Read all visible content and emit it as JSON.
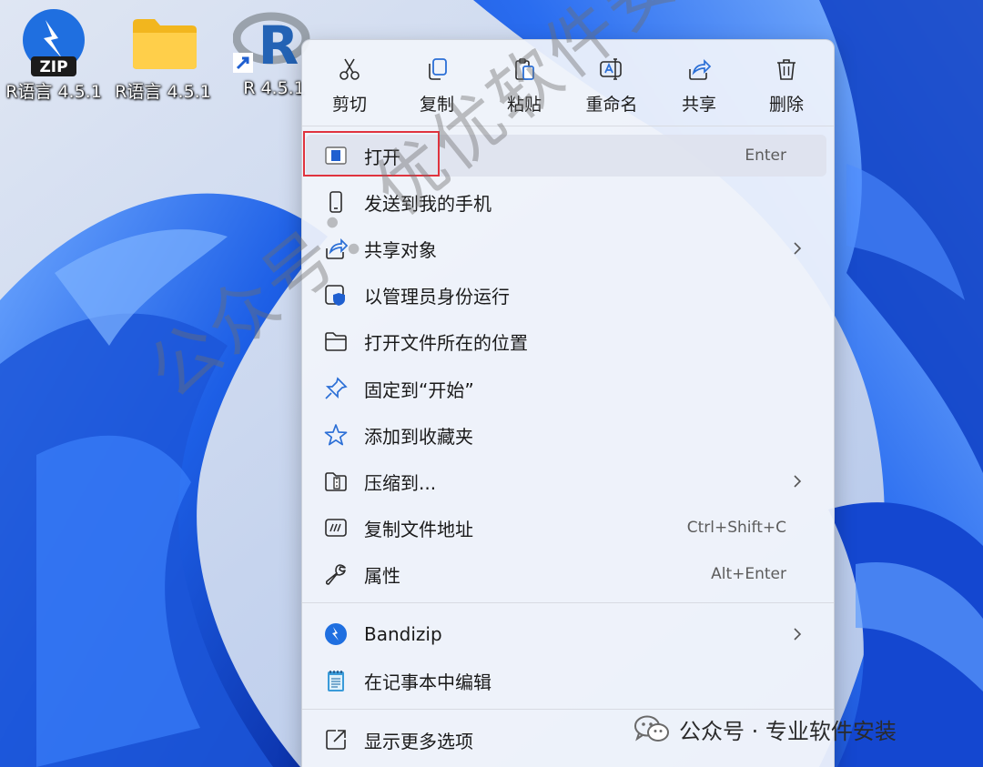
{
  "desktop": {
    "icons": [
      {
        "label": "R语言 4.5.1",
        "badge": "ZIP",
        "icon": "bandizip-zip-icon"
      },
      {
        "label": "R语言 4.5.1",
        "icon": "folder-icon"
      },
      {
        "label": "R 4.5.1",
        "letter": "R",
        "icon": "r-app-shortcut-icon"
      }
    ]
  },
  "context_menu": {
    "quick_actions": [
      {
        "label": "剪切",
        "icon": "scissors-icon"
      },
      {
        "label": "复制",
        "icon": "copy-icon"
      },
      {
        "label": "粘贴",
        "icon": "paste-icon"
      },
      {
        "label": "重命名",
        "icon": "rename-icon"
      },
      {
        "label": "共享",
        "icon": "share-icon"
      },
      {
        "label": "删除",
        "icon": "trash-icon"
      }
    ],
    "items": [
      {
        "label": "打开",
        "shortcut": "Enter",
        "icon": "open-app-icon"
      },
      {
        "label": "发送到我的手机",
        "icon": "phone-icon"
      },
      {
        "label": "共享对象",
        "icon": "share-icon",
        "submenu": true
      },
      {
        "label": "以管理员身份运行",
        "icon": "admin-shield-icon"
      },
      {
        "label": "打开文件所在的位置",
        "icon": "folder-outline-icon"
      },
      {
        "label": "固定到“开始”",
        "icon": "pin-icon"
      },
      {
        "label": "添加到收藏夹",
        "icon": "star-icon"
      },
      {
        "label": "压缩到...",
        "icon": "zip-archive-icon",
        "submenu": true
      },
      {
        "label": "复制文件地址",
        "shortcut": "Ctrl+Shift+C",
        "icon": "copy-path-icon"
      },
      {
        "label": "属性",
        "shortcut": "Alt+Enter",
        "icon": "wrench-icon"
      },
      {
        "label": "Bandizip",
        "icon": "bandizip-icon",
        "submenu": true
      },
      {
        "label": "在记事本中编辑",
        "icon": "notepad-icon"
      },
      {
        "label": "显示更多选项",
        "icon": "more-options-icon"
      }
    ]
  },
  "watermark": "公众号：优优软件安装",
  "credit": "公众号 · 专业软件安装",
  "colors": {
    "highlight_border": "#e0333e",
    "accent": "#2b6fd6",
    "wallpaper_blue": "#1b5ee8"
  }
}
